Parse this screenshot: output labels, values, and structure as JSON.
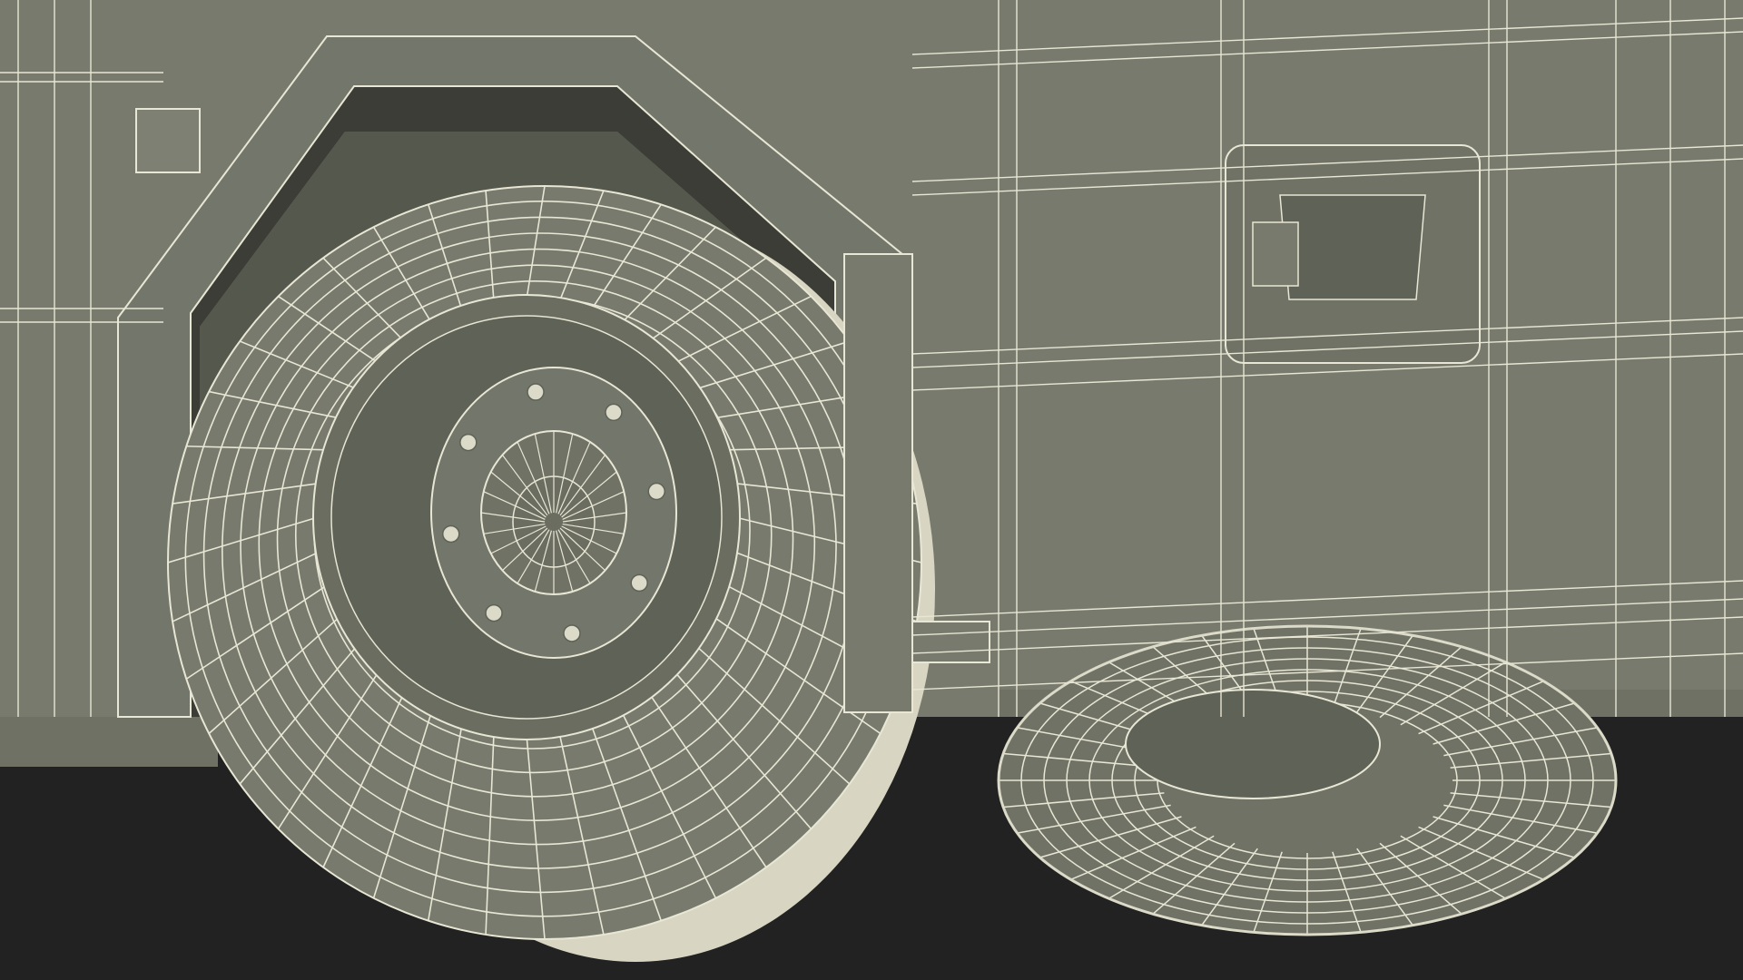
{
  "scene": {
    "subject": "vehicle-rear-wheels-wireframe",
    "colors": {
      "background": "#222222",
      "body_fill": "#777a6c",
      "body_shadow": "#5f6257",
      "wire": "#e8e6d4",
      "tire_highlight": "#dcdac8",
      "arch_shadow": "#3b3d36"
    }
  }
}
